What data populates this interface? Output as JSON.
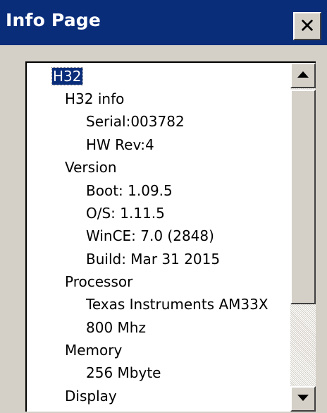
{
  "window": {
    "title": "Info Page",
    "close_icon": "close-icon"
  },
  "tree": {
    "root": {
      "label": "H32",
      "selected": true
    },
    "groups": [
      {
        "label": "H32 info",
        "children": [
          "Serial:003782",
          "HW Rev:4"
        ]
      },
      {
        "label": "Version",
        "children": [
          "Boot: 1.09.5",
          "O/S: 1.11.5",
          "WinCE: 7.0 (2848)",
          "Build: Mar 31 2015"
        ]
      },
      {
        "label": "Processor",
        "children": [
          "Texas Instruments AM33X",
          "800 Mhz"
        ]
      },
      {
        "label": "Memory",
        "children": [
          "256 Mbyte"
        ]
      },
      {
        "label": "Display",
        "children": []
      }
    ]
  },
  "scrollbar": {
    "up_icon": "arrow-up-icon",
    "down_icon": "arrow-down-icon"
  }
}
